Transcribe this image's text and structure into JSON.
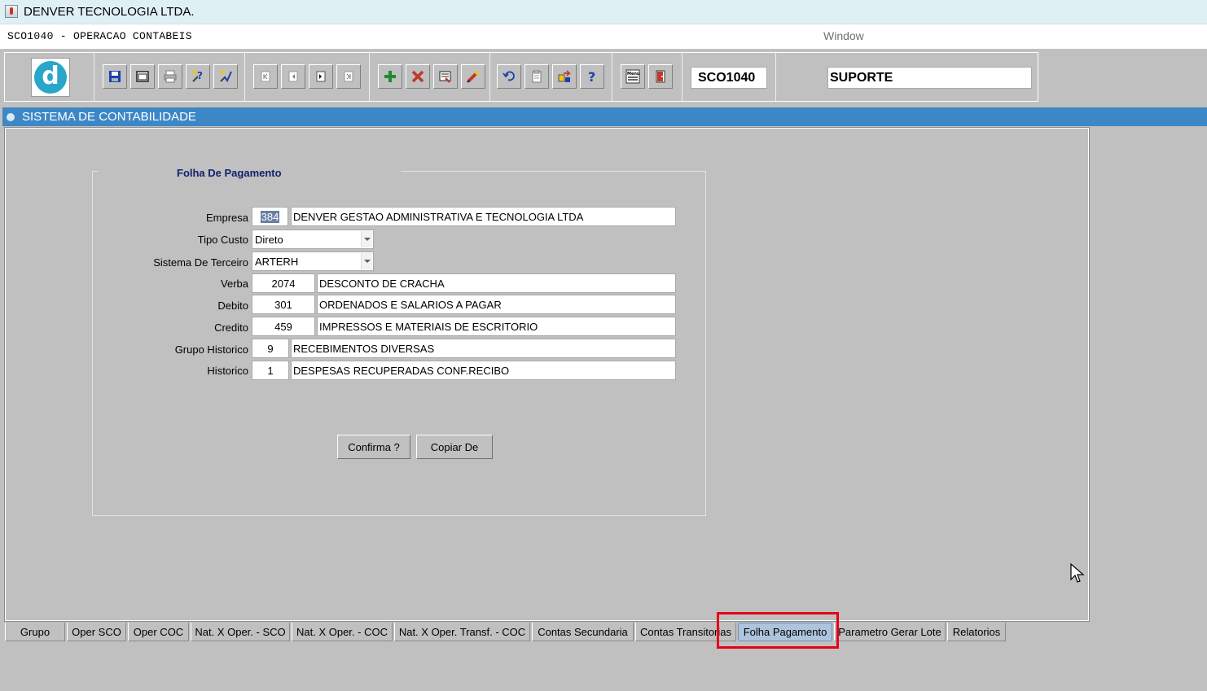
{
  "window": {
    "title": "DENVER TECNOLOGIA LTDA.",
    "form_title": "SCO1040 - OPERACAO CONTABEIS",
    "window_menu": "Window"
  },
  "toolbar": {
    "logo_letter": "d",
    "form_code": "SCO1040",
    "user": "SUPORTE",
    "menu_icon_label": "Menu"
  },
  "formbar": {
    "title": "SISTEMA DE CONTABILIDADE"
  },
  "frame": {
    "title": "Folha De Pagamento"
  },
  "fields": {
    "empresa": {
      "label": "Empresa",
      "code": "384",
      "desc": "DENVER GESTAO ADMINISTRATIVA E TECNOLOGIA LTDA"
    },
    "tipo_custo": {
      "label": "Tipo Custo",
      "value": "Direto"
    },
    "sistema_terceiro": {
      "label": "Sistema De Terceiro",
      "value": "ARTERH"
    },
    "verba": {
      "label": "Verba",
      "code": "2074",
      "desc": "DESCONTO DE CRACHA"
    },
    "debito": {
      "label": "Debito",
      "code": "301",
      "desc": "ORDENADOS E SALARIOS A PAGAR"
    },
    "credito": {
      "label": "Credito",
      "code": "459",
      "desc": "IMPRESSOS E MATERIAIS DE ESCRITORIO"
    },
    "grupo_historico": {
      "label": "Grupo Historico",
      "code": "9",
      "desc": "RECEBIMENTOS DIVERSAS"
    },
    "historico": {
      "label": "Historico",
      "code": "1",
      "desc": "DESPESAS RECUPERADAS CONF.RECIBO"
    }
  },
  "buttons": {
    "confirma": "Confirma ?",
    "copiar": "Copiar De"
  },
  "tabs": [
    "Grupo",
    "Oper SCO",
    "Oper COC",
    "Nat. X Oper. - SCO",
    "Nat. X Oper. - COC",
    "Nat. X Oper. Transf. - COC",
    "Contas Secundaria",
    "Contas Transitorias",
    "Folha Pagamento",
    "Parametro Gerar Lote",
    "Relatorios"
  ],
  "active_tab": "Folha Pagamento",
  "colors": {
    "header_blue": "#3d87c7",
    "highlight_red": "#e5001a",
    "active_tab": "#aec4dd"
  }
}
